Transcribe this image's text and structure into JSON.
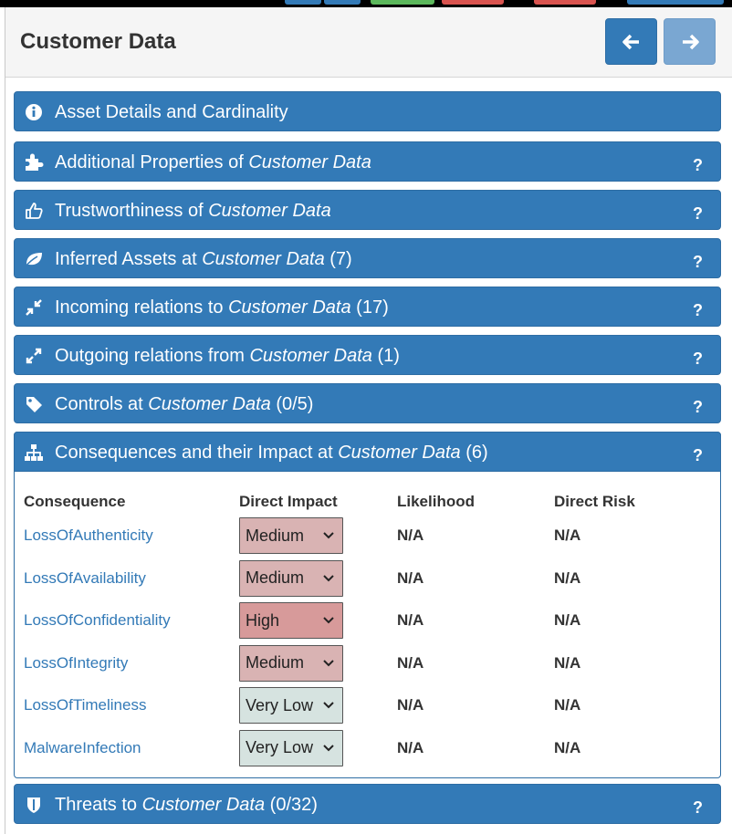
{
  "panel": {
    "title": "Customer Data",
    "back_icon": "arrow-left-icon",
    "forward_icon": "arrow-right-icon"
  },
  "colors": {
    "primary": "#337ab7",
    "medium": "#d9b3b3",
    "high": "#d79a9a",
    "very_low": "#d6e3e0",
    "link": "#337ab7"
  },
  "sections": [
    {
      "icon": "info-circle-icon",
      "prefix": "Asset Details and Cardinality",
      "asset": "",
      "suffix": "",
      "help": ""
    },
    {
      "icon": "puzzle-icon",
      "prefix": "Additional Properties of ",
      "asset": "Customer Data",
      "suffix": "",
      "help": "?"
    },
    {
      "icon": "thumbs-up-icon",
      "prefix": "Trustworthiness of ",
      "asset": "Customer Data",
      "suffix": "",
      "help": "?"
    },
    {
      "icon": "leaf-icon",
      "prefix": "Inferred Assets at ",
      "asset": "Customer Data",
      "suffix": " (7)",
      "help": "?"
    },
    {
      "icon": "compress-arrows-icon",
      "prefix": "Incoming relations to ",
      "asset": "Customer Data",
      "suffix": " (17)",
      "help": "?"
    },
    {
      "icon": "expand-arrows-icon",
      "prefix": "Outgoing relations from ",
      "asset": "Customer Data",
      "suffix": " (1)",
      "help": "?"
    },
    {
      "icon": "tag-icon",
      "prefix": "Controls at ",
      "asset": "Customer Data",
      "suffix": " (0/5)",
      "help": "?"
    },
    {
      "icon": "sitemap-icon",
      "prefix": "Consequences and their Impact at ",
      "asset": "Customer Data",
      "suffix": " (6)",
      "help": "?"
    },
    {
      "icon": "shield-icon",
      "prefix": "Threats to ",
      "asset": "Customer Data",
      "suffix": " (0/32)",
      "help": "?"
    }
  ],
  "consequences": {
    "headers": [
      "Consequence",
      "Direct Impact",
      "Likelihood",
      "Direct Risk"
    ],
    "rows": [
      {
        "name": "LossOfAuthenticity",
        "impact": "Medium",
        "likelihood": "N/A",
        "risk": "N/A"
      },
      {
        "name": "LossOfAvailability",
        "impact": "Medium",
        "likelihood": "N/A",
        "risk": "N/A"
      },
      {
        "name": "LossOfConfidentiality",
        "impact": "High",
        "likelihood": "N/A",
        "risk": "N/A"
      },
      {
        "name": "LossOfIntegrity",
        "impact": "Medium",
        "likelihood": "N/A",
        "risk": "N/A"
      },
      {
        "name": "LossOfTimeliness",
        "impact": "Very Low",
        "likelihood": "N/A",
        "risk": "N/A"
      },
      {
        "name": "MalwareInfection",
        "impact": "Very Low",
        "likelihood": "N/A",
        "risk": "N/A"
      }
    ]
  }
}
